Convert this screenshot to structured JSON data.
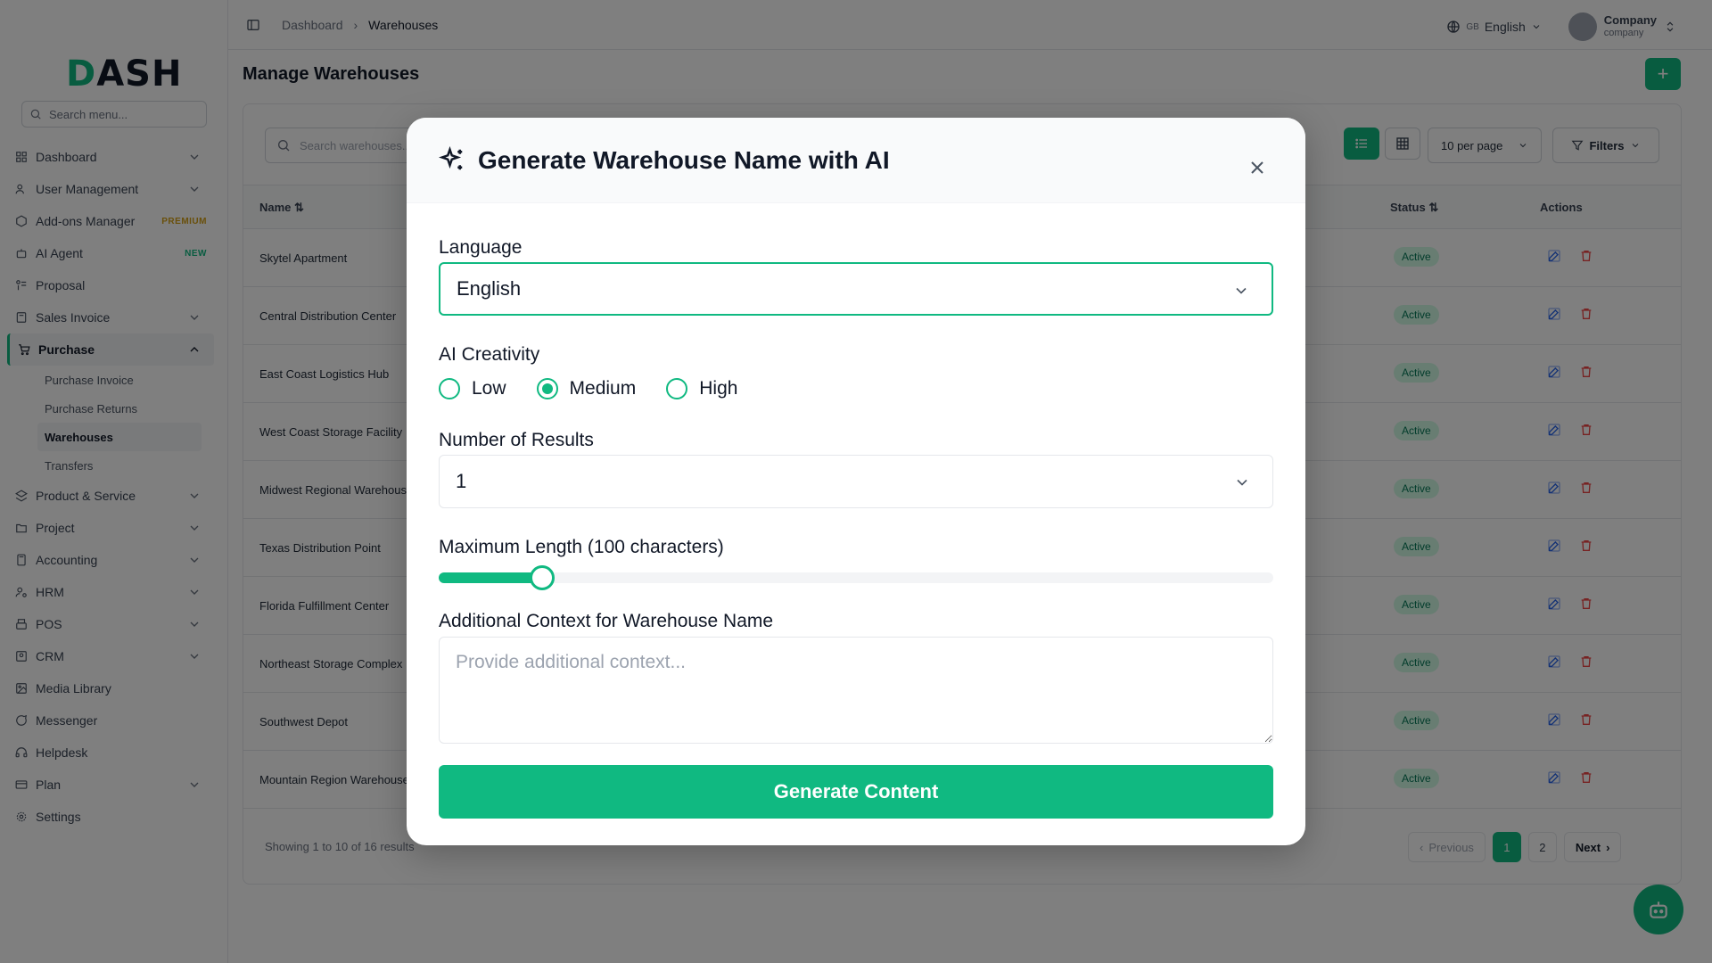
{
  "brand": {
    "logo_text": "ASH",
    "logo_first": "D"
  },
  "sidebar": {
    "search_placeholder": "Search menu...",
    "items": [
      {
        "label": "Dashboard"
      },
      {
        "label": "User Management"
      },
      {
        "label": "Add-ons Manager",
        "badge": "PREMIUM"
      },
      {
        "label": "AI Agent",
        "badge": "NEW"
      },
      {
        "label": "Proposal"
      },
      {
        "label": "Sales Invoice"
      },
      {
        "label": "Purchase"
      },
      {
        "label": "Product & Service"
      },
      {
        "label": "Project"
      },
      {
        "label": "Accounting"
      },
      {
        "label": "HRM"
      },
      {
        "label": "POS"
      },
      {
        "label": "CRM"
      },
      {
        "label": "Media Library"
      },
      {
        "label": "Messenger"
      },
      {
        "label": "Helpdesk"
      },
      {
        "label": "Plan"
      },
      {
        "label": "Settings"
      }
    ],
    "purchase_sub": [
      "Purchase Invoice",
      "Purchase Returns",
      "Warehouses",
      "Transfers"
    ]
  },
  "topbar": {
    "breadcrumb": [
      "Dashboard",
      "Warehouses"
    ],
    "lang_code": "GB",
    "lang": "English",
    "company": "Company",
    "company_sub": "company"
  },
  "page": {
    "title": "Manage Warehouses",
    "search_placeholder": "Search warehouses...",
    "per_page": "10 per page",
    "filters": "Filters",
    "columns": {
      "name": "Name",
      "status": "Status",
      "actions": "Actions"
    },
    "rows": [
      {
        "name": "Skytel Apartment",
        "status": "Active"
      },
      {
        "name": "Central Distribution Center",
        "status": "Active"
      },
      {
        "name": "East Coast Logistics Hub",
        "status": "Active"
      },
      {
        "name": "West Coast Storage Facility",
        "status": "Active"
      },
      {
        "name": "Midwest Regional Warehouse",
        "status": "Active"
      },
      {
        "name": "Texas Distribution Point",
        "status": "Active"
      },
      {
        "name": "Florida Fulfillment Center",
        "status": "Active"
      },
      {
        "name": "Northeast Storage Complex",
        "status": "Active"
      },
      {
        "name": "Southwest Depot",
        "status": "Active"
      },
      {
        "name": "Mountain Region Warehouse",
        "status": "Active"
      }
    ],
    "showing": "Showing 1 to 10 of 16 results",
    "pager": {
      "prev": "Previous",
      "pages": [
        "1",
        "2"
      ],
      "next": "Next"
    }
  },
  "modal": {
    "title": "Generate Warehouse Name with AI",
    "language_label": "Language",
    "language_value": "English",
    "creativity_label": "AI Creativity",
    "creativity_options": [
      "Low",
      "Medium",
      "High"
    ],
    "creativity_selected": "Medium",
    "results_label": "Number of Results",
    "results_value": "1",
    "maxlen_label": "Maximum Length (100 characters)",
    "maxlen_fraction": 0.124,
    "context_label": "Additional Context for Warehouse Name",
    "context_placeholder": "Provide additional context...",
    "generate_button": "Generate Content"
  },
  "colors": {
    "accent": "#10b981",
    "danger": "#ef4444",
    "edit": "#2563eb"
  }
}
